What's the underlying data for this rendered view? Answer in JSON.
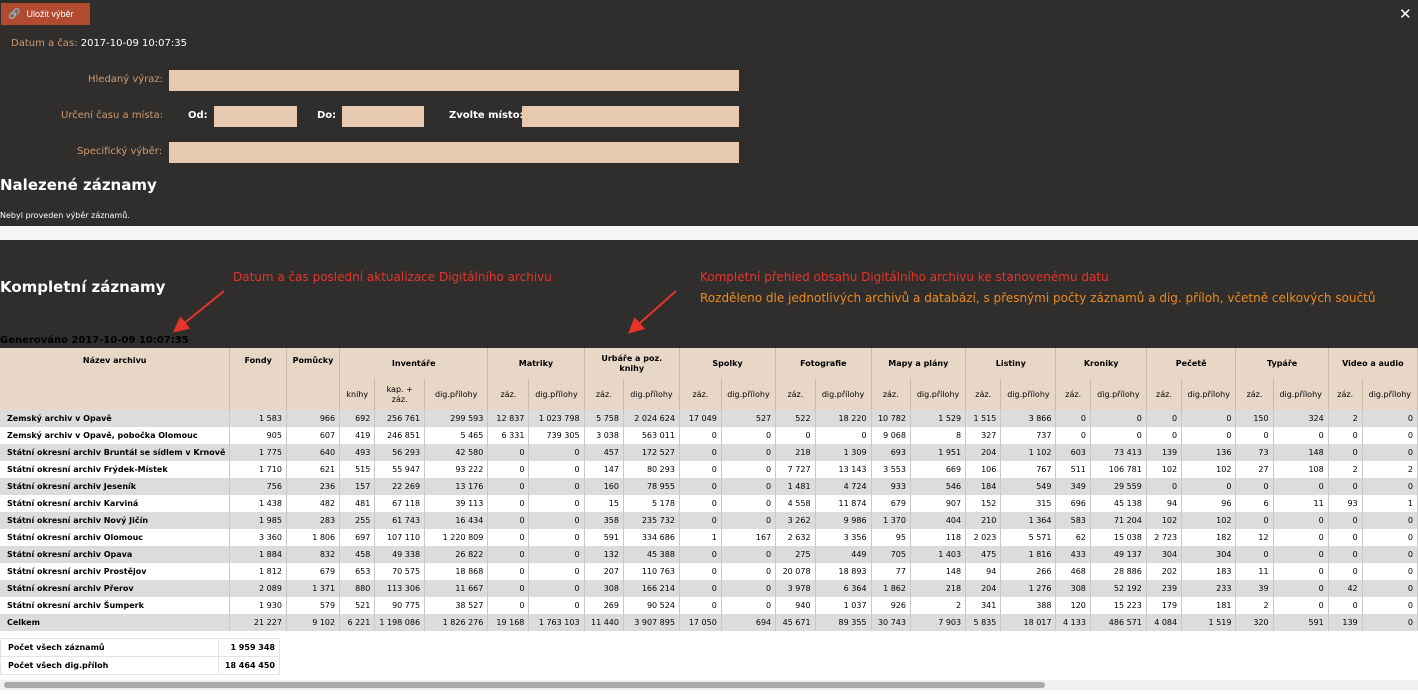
{
  "toolbar": {
    "save_label": "Uložit výběr",
    "close_label": "✕"
  },
  "form": {
    "datetime_label": "Datum a čas:",
    "datetime_value": "2017-10-09 10:07:35",
    "search_label": "Hledaný výraz:",
    "timeplace_label": "Určení času a místa:",
    "from_label": "Od:",
    "to_label": "Do:",
    "place_label": "Zvolte místo:",
    "specific_label": "Specifický výběr:",
    "search_value": "",
    "from_value": "",
    "to_value": "",
    "place_value": "",
    "specific_value": ""
  },
  "found": {
    "title": "Nalezené záznamy",
    "note": "Nebyl proveden výběr záznamů."
  },
  "complete": {
    "title": "Kompletní záznamy",
    "generated": "Generováno 2017-10-09 10:07:35",
    "annotation_left": "Datum a čas poslední aktualizace Digitálního archivu",
    "annotation_right_1": "Kompletní přehled obsahu Digitálního archivu ke stanovenému datu",
    "annotation_right_2": "Rozděleno dle jednotlivých archivů a databází, s přesnými počty záznamů a dig. příloh, včetně celkových součtů"
  },
  "colors": {
    "dark_bg": "#2f2e2d",
    "accent": "#b24a2f",
    "label": "#ce9a6e",
    "field": "#e6c9ae",
    "annotation_red": "#e8332a",
    "annotation_orange": "#ee8a1e",
    "header_bg": "#e8d7c7"
  },
  "table": {
    "groups": [
      "Název archivu",
      "Fondy",
      "Pomůcky",
      "Inventáře",
      "Matriky",
      "Urbáře a poz. knihy",
      "Spolky",
      "Fotografie",
      "Mapy a plány",
      "Listiny",
      "Kroniky",
      "Pečetě",
      "Typáře",
      "Video a audio"
    ],
    "subheaders": [
      "knihy",
      "kap. + záz.",
      "dig.přílohy",
      "záz.",
      "dig.přílohy",
      "záz.",
      "dig.přílohy",
      "záz.",
      "dig.přílohy",
      "záz.",
      "dig.přílohy",
      "záz.",
      "dig.přílohy",
      "záz.",
      "dig.přílohy",
      "záz.",
      "dig.přílohy",
      "záz.",
      "dig.přílohy",
      "záz.",
      "dig.přílohy",
      "záz.",
      "dig.přílohy"
    ],
    "rows": [
      [
        "Zemský archiv v Opavě",
        "1 583",
        "966",
        "692",
        "256 761",
        "299 593",
        "12 837",
        "1 023 798",
        "5 758",
        "2 024 624",
        "17 049",
        "527",
        "522",
        "18 220",
        "10 782",
        "1 529",
        "1 515",
        "3 866",
        "0",
        "0",
        "0",
        "0",
        "150",
        "324",
        "2",
        "0"
      ],
      [
        "Zemský archiv v Opavě, pobočka Olomouc",
        "905",
        "607",
        "419",
        "246 851",
        "5 465",
        "6 331",
        "739 305",
        "3 038",
        "563 011",
        "0",
        "0",
        "0",
        "0",
        "9 068",
        "8",
        "327",
        "737",
        "0",
        "0",
        "0",
        "0",
        "0",
        "0",
        "0",
        "0"
      ],
      [
        "Státní okresní archiv Bruntál se sídlem v Krnově",
        "1 775",
        "640",
        "493",
        "56 293",
        "42 580",
        "0",
        "0",
        "457",
        "172 527",
        "0",
        "0",
        "218",
        "1 309",
        "693",
        "1 951",
        "204",
        "1 102",
        "603",
        "73 413",
        "139",
        "136",
        "73",
        "148",
        "0",
        "0"
      ],
      [
        "Státní okresní archiv Frýdek-Místek",
        "1 710",
        "621",
        "515",
        "55 947",
        "93 222",
        "0",
        "0",
        "147",
        "80 293",
        "0",
        "0",
        "7 727",
        "13 143",
        "3 553",
        "669",
        "106",
        "767",
        "511",
        "106 781",
        "102",
        "102",
        "27",
        "108",
        "2",
        "2"
      ],
      [
        "Státní okresní archiv Jeseník",
        "756",
        "236",
        "157",
        "22 269",
        "13 176",
        "0",
        "0",
        "160",
        "78 955",
        "0",
        "0",
        "1 481",
        "4 724",
        "933",
        "546",
        "184",
        "549",
        "349",
        "29 559",
        "0",
        "0",
        "0",
        "0",
        "0",
        "0"
      ],
      [
        "Státní okresní archiv Karviná",
        "1 438",
        "482",
        "481",
        "67 118",
        "39 113",
        "0",
        "0",
        "15",
        "5 178",
        "0",
        "0",
        "4 558",
        "11 874",
        "679",
        "907",
        "152",
        "315",
        "696",
        "45 138",
        "94",
        "96",
        "6",
        "11",
        "93",
        "1"
      ],
      [
        "Státní okresní archiv Nový Jičín",
        "1 985",
        "283",
        "255",
        "61 743",
        "16 434",
        "0",
        "0",
        "358",
        "235 732",
        "0",
        "0",
        "3 262",
        "9 986",
        "1 370",
        "404",
        "210",
        "1 364",
        "583",
        "71 204",
        "102",
        "102",
        "0",
        "0",
        "0",
        "0"
      ],
      [
        "Státní okresní archiv Olomouc",
        "3 360",
        "1 806",
        "697",
        "107 110",
        "1 220 809",
        "0",
        "0",
        "591",
        "334 686",
        "1",
        "167",
        "2 632",
        "3 356",
        "95",
        "118",
        "2 023",
        "5 571",
        "62",
        "15 038",
        "2 723",
        "182",
        "12",
        "0",
        "0",
        "0"
      ],
      [
        "Státní okresní archiv Opava",
        "1 884",
        "832",
        "458",
        "49 338",
        "26 822",
        "0",
        "0",
        "132",
        "45 388",
        "0",
        "0",
        "275",
        "449",
        "705",
        "1 403",
        "475",
        "1 816",
        "433",
        "49 137",
        "304",
        "304",
        "0",
        "0",
        "0",
        "0"
      ],
      [
        "Státní okresní archiv Prostějov",
        "1 812",
        "679",
        "653",
        "70 575",
        "18 868",
        "0",
        "0",
        "207",
        "110 763",
        "0",
        "0",
        "20 078",
        "18 893",
        "77",
        "148",
        "94",
        "266",
        "468",
        "28 886",
        "202",
        "183",
        "11",
        "0",
        "0",
        "0"
      ],
      [
        "Státní okresní archiv Přerov",
        "2 089",
        "1 371",
        "880",
        "113 306",
        "11 667",
        "0",
        "0",
        "308",
        "166 214",
        "0",
        "0",
        "3 978",
        "6 364",
        "1 862",
        "218",
        "204",
        "1 276",
        "308",
        "52 192",
        "239",
        "233",
        "39",
        "0",
        "42",
        "0"
      ],
      [
        "Státní okresní archiv Šumperk",
        "1 930",
        "579",
        "521",
        "90 775",
        "38 527",
        "0",
        "0",
        "269",
        "90 524",
        "0",
        "0",
        "940",
        "1 037",
        "926",
        "2",
        "341",
        "388",
        "120",
        "15 223",
        "179",
        "181",
        "2",
        "0",
        "0",
        "0"
      ]
    ],
    "total": [
      "Celkem",
      "21 227",
      "9 102",
      "6 221",
      "1 198 086",
      "1 826 276",
      "19 168",
      "1 763 103",
      "11 440",
      "3 907 895",
      "17 050",
      "694",
      "45 671",
      "89 355",
      "30 743",
      "7 903",
      "5 835",
      "18 017",
      "4 133",
      "486 571",
      "4 084",
      "1 519",
      "320",
      "591",
      "139",
      "0"
    ],
    "summary": [
      {
        "label": "Počet všech záznamů",
        "value": "1 959 348"
      },
      {
        "label": "Počet všech dig.příloh",
        "value": "18 464 450"
      }
    ]
  }
}
